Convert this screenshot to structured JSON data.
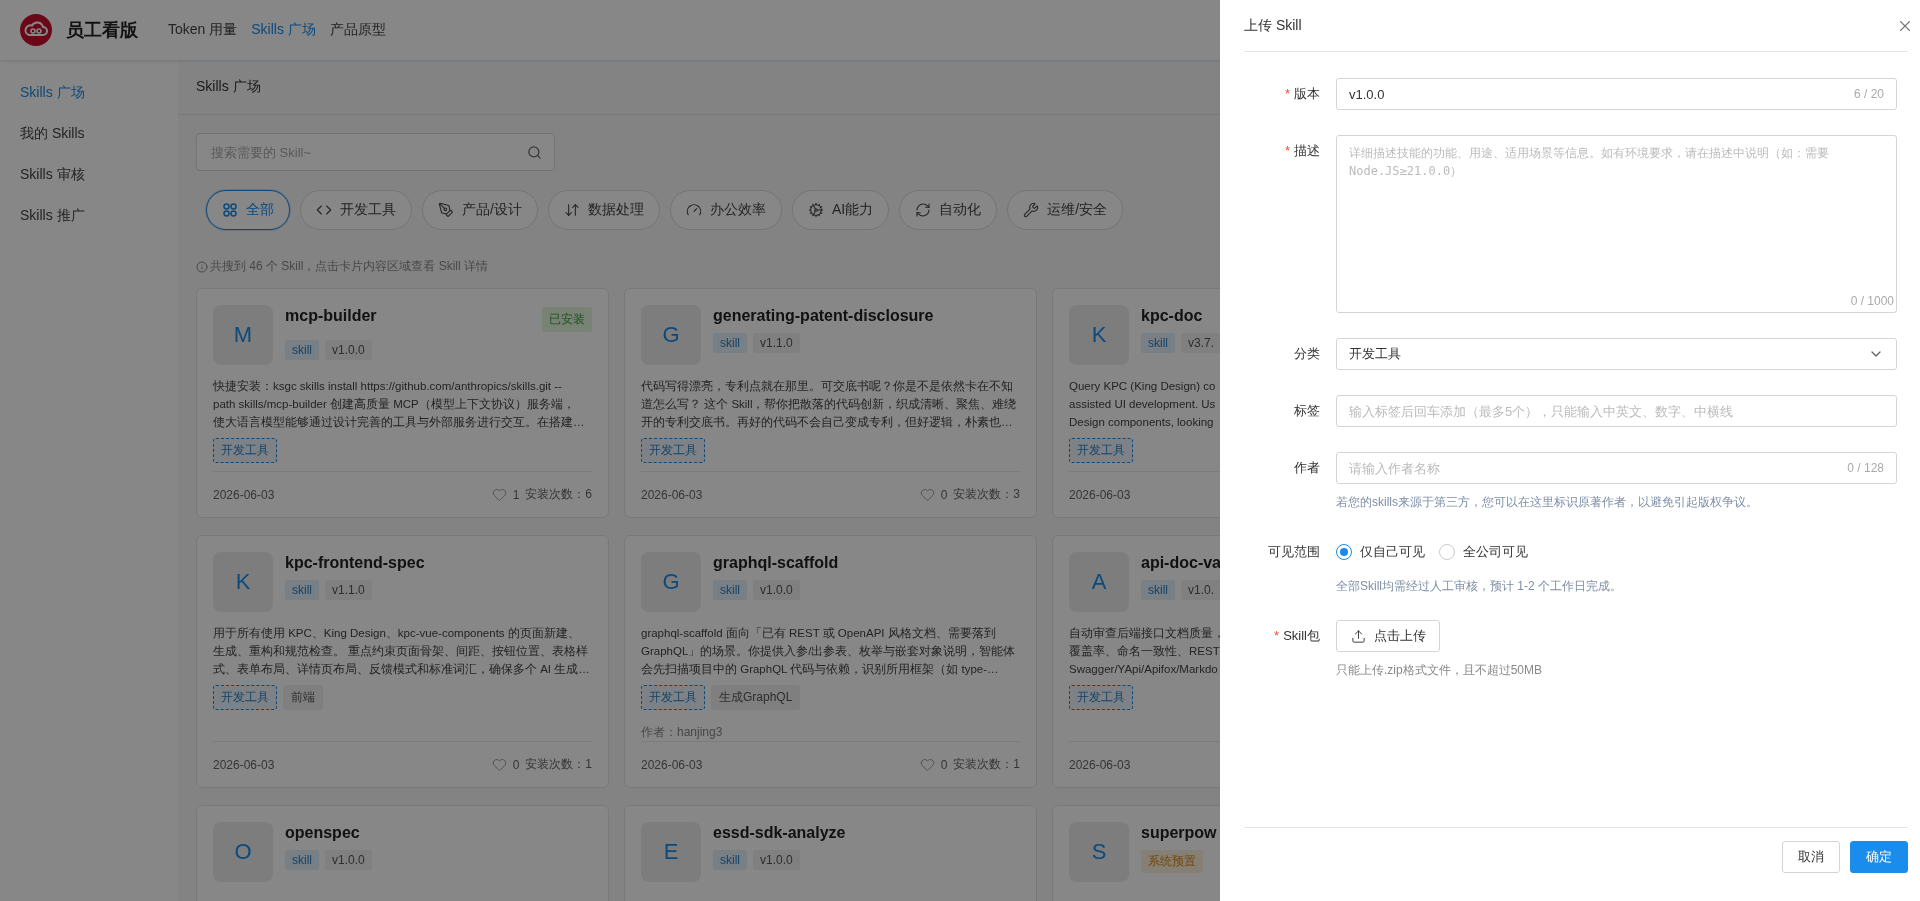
{
  "header": {
    "logo_text": "员工看版",
    "nav": [
      {
        "label": "Token 用量",
        "selected": false
      },
      {
        "label": "Skills 广场",
        "selected": true
      },
      {
        "label": "产品原型",
        "selected": false
      }
    ]
  },
  "sidebar": {
    "items": [
      {
        "label": "Skills 广场",
        "selected": true
      },
      {
        "label": "我的 Skills",
        "selected": false
      },
      {
        "label": "Skills 审核",
        "selected": false
      },
      {
        "label": "Skills 推广",
        "selected": false
      }
    ]
  },
  "page_title": "Skills 广场",
  "search": {
    "placeholder": "搜索需要的 Skill~"
  },
  "categories": [
    {
      "label": "全部",
      "selected": true
    },
    {
      "label": "开发工具",
      "selected": false
    },
    {
      "label": "产品/设计",
      "selected": false
    },
    {
      "label": "数据处理",
      "selected": false
    },
    {
      "label": "办公效率",
      "selected": false
    },
    {
      "label": "AI能力",
      "selected": false
    },
    {
      "label": "自动化",
      "selected": false
    },
    {
      "label": "运维/安全",
      "selected": false
    }
  ],
  "result_info": "共搜到 46 个 Skill，点击卡片内容区域查看 Skill 详情",
  "cards": [
    {
      "avatar": "M",
      "title": "mcp-builder",
      "badge": "已安装",
      "tags": [
        {
          "label": "skill",
          "kind": "type"
        },
        {
          "label": "v1.0.0",
          "kind": "version"
        }
      ],
      "description_lines": [
        "快捷安装：ksgc skills install https://github.com/anthropics/skills.git --",
        "path skills/mcp-builder 创建高质量 MCP（模型上下文协议）服务端，",
        "使大语言模型能够通过设计完善的工具与外部服务进行交互。在搭建…"
      ],
      "labels": [
        {
          "label": "开发工具",
          "kind": "category"
        }
      ],
      "date": "2026-06-03",
      "likes": "1",
      "installs": "安装次数：6"
    },
    {
      "avatar": "G",
      "title": "generating-patent-disclosure",
      "tags": [
        {
          "label": "skill",
          "kind": "type"
        },
        {
          "label": "v1.1.0",
          "kind": "version"
        }
      ],
      "description_lines": [
        "代码写得漂亮，专利点就在那里。可交底书呢？你是不是依然卡在不知",
        "道怎么写？ 这个 Skill，帮你把散落的代码创新，织成清晰、聚焦、难绕",
        "开的专利交底书。再好的代码不会自己变成专利，但好逻辑，朴素也…"
      ],
      "labels": [
        {
          "label": "开发工具",
          "kind": "category"
        }
      ],
      "date": "2026-06-03",
      "likes": "0",
      "installs": "安装次数：3"
    },
    {
      "avatar": "K",
      "title": "kpc-doc",
      "tags": [
        {
          "label": "skill",
          "kind": "type"
        },
        {
          "label": "v3.7.",
          "kind": "version"
        }
      ],
      "description_lines": [
        "Query KPC (King Design) co",
        "assisted UI development. Us",
        "Design components, looking"
      ],
      "labels": [
        {
          "label": "开发工具",
          "kind": "category"
        }
      ],
      "date": "2026-06-03"
    },
    {
      "avatar": "K",
      "title": "kpc-frontend-spec",
      "tags": [
        {
          "label": "skill",
          "kind": "type"
        },
        {
          "label": "v1.1.0",
          "kind": "version"
        }
      ],
      "description_lines": [
        "用于所有使用 KPC、King Design、kpc-vue-components 的页面新建、",
        "生成、重构和规范检查。 重点约束页面骨架、间距、按钮位置、表格样",
        "式、表单布局、详情页布局、反馈模式和标准词汇，确保多个 AI 生成…"
      ],
      "labels": [
        {
          "label": "开发工具",
          "kind": "category"
        },
        {
          "label": "前端",
          "kind": "plain"
        }
      ],
      "date": "2026-06-03",
      "likes": "0",
      "installs": "安装次数：1"
    },
    {
      "avatar": "G",
      "title": "graphql-scaffold",
      "tags": [
        {
          "label": "skill",
          "kind": "type"
        },
        {
          "label": "v1.0.0",
          "kind": "version"
        }
      ],
      "description_lines": [
        "graphql-scaffold 面向「已有 REST 或 OpenAPI 风格文档、需要落到",
        "GraphQL」的场景。你提供入参/出参表、枚举与嵌套对象说明，智能体",
        "会先扫描项目中的 GraphQL 代码与依赖，识别所用框架（如 type-…"
      ],
      "labels": [
        {
          "label": "开发工具",
          "kind": "category"
        },
        {
          "label": "生成GraphQL",
          "kind": "plain"
        }
      ],
      "author": "作者：hanjing3",
      "date": "2026-06-03",
      "likes": "0",
      "installs": "安装次数：1"
    },
    {
      "avatar": "A",
      "title": "api-doc-va",
      "tags": [
        {
          "label": "skill",
          "kind": "type"
        },
        {
          "label": "v1.0.",
          "kind": "version"
        }
      ],
      "description_lines": [
        "自动审查后端接口文档质量，",
        "覆盖率、命名一致性、REST",
        "Swagger/YApi/Apifox/Markdo"
      ],
      "labels": [
        {
          "label": "开发工具",
          "kind": "category"
        }
      ],
      "date": "2026-06-03"
    },
    {
      "avatar": "O",
      "title": "openspec",
      "tags": [
        {
          "label": "skill",
          "kind": "type"
        },
        {
          "label": "v1.0.0",
          "kind": "version"
        }
      ]
    },
    {
      "avatar": "E",
      "title": "essd-sdk-analyze",
      "tags": [
        {
          "label": "skill",
          "kind": "type"
        },
        {
          "label": "v1.0.0",
          "kind": "version"
        }
      ]
    },
    {
      "avatar": "S",
      "title": "superpow",
      "tags": [
        {
          "label": "系统预置",
          "kind": "preset"
        }
      ]
    }
  ],
  "drawer": {
    "title": "上传 Skill",
    "version": {
      "label": "版本",
      "required_mark": "*",
      "value": "v1.0.0",
      "count": "6 / 20"
    },
    "description": {
      "label": "描述",
      "required_mark": "*",
      "placeholder": "详细描述技能的功能、用途、适用场景等信息。如有环境要求，请在描述中说明（如：需要Node.JS≥21.0.0）",
      "count": "0 / 1000"
    },
    "category": {
      "label": "分类",
      "value": "开发工具"
    },
    "tags": {
      "label": "标签",
      "placeholder": "输入标签后回车添加（最多5个），只能输入中英文、数字、中横线"
    },
    "author": {
      "label": "作者",
      "placeholder": "请输入作者名称",
      "count": "0 / 128",
      "help": "若您的skills来源于第三方，您可以在这里标识原著作者，以避免引起版权争议。"
    },
    "visibility": {
      "label": "可见范围",
      "options": [
        {
          "label": "仅自己可见",
          "selected": true
        },
        {
          "label": "全公司可见",
          "selected": false
        }
      ],
      "help": "全部Skill均需经过人工审核，预计 1-2 个工作日完成。"
    },
    "package": {
      "label": "Skill包",
      "required_mark": "*",
      "button": "点击上传",
      "help": "只能上传.zip格式文件，且不超过50MB"
    },
    "buttons": [
      {
        "label": "取消",
        "kind": "secondary"
      },
      {
        "label": "确定",
        "kind": "primary"
      }
    ]
  }
}
